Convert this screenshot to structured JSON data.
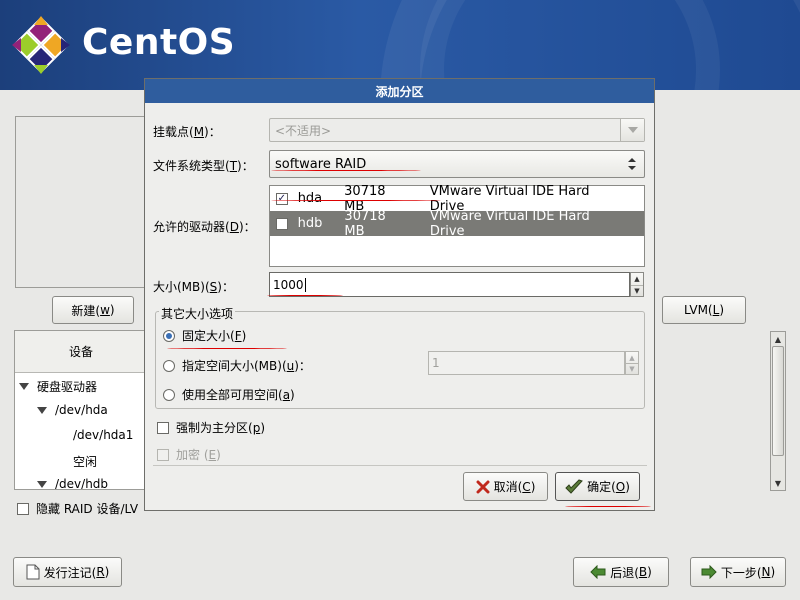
{
  "header": {
    "brand": "CentOS"
  },
  "main": {
    "new_button": {
      "label": "新建(",
      "mnemonic": "w",
      "suffix": ")"
    },
    "lvm_button": {
      "label": "LVM(",
      "mnemonic": "L",
      "suffix": ")"
    },
    "tree": {
      "column_header": "设备",
      "rows": [
        "硬盘驱动器",
        "/dev/hda",
        "/dev/hda1",
        "空闲",
        "/dev/hdb"
      ]
    },
    "hide_raid_label": "隐藏 RAID 设备/LV",
    "release_notes": {
      "label": "发行注记(",
      "mnemonic": "R",
      "suffix": ")"
    },
    "back": {
      "label": "后退(",
      "mnemonic": "B",
      "suffix": ")"
    },
    "next": {
      "label": "下一步(",
      "mnemonic": "N",
      "suffix": ")"
    }
  },
  "dialog": {
    "title": "添加分区",
    "mount_point": {
      "label": "挂载点(",
      "mnemonic": "M",
      "suffix": ")：",
      "value": "<不适用>"
    },
    "fs_type": {
      "label": "文件系统类型(",
      "mnemonic": "T",
      "suffix": ")：",
      "value": "software RAID"
    },
    "drives": {
      "label": "允许的驱动器(",
      "mnemonic": "D",
      "suffix": ")：",
      "rows": [
        {
          "checked": true,
          "name": "hda",
          "size": "30718 MB",
          "model": "VMware Virtual IDE Hard Drive"
        },
        {
          "checked": false,
          "name": "hdb",
          "size": "30718 MB",
          "model": "VMware Virtual IDE Hard Drive"
        }
      ]
    },
    "size": {
      "label": "大小(MB)(",
      "mnemonic": "S",
      "suffix": ")：",
      "value": "1000"
    },
    "options": {
      "legend": "其它大小选项",
      "fixed": {
        "label": "固定大小(",
        "mnemonic": "F",
        "suffix": ")"
      },
      "max": {
        "label": "指定空间大小(MB)(",
        "mnemonic": "u",
        "suffix": ")：",
        "value": "1"
      },
      "fill": {
        "label": "使用全部可用空间(",
        "mnemonic": "a",
        "suffix": ")"
      }
    },
    "primary": {
      "label": "强制为主分区(",
      "mnemonic": "p",
      "suffix": ")"
    },
    "encrypt": {
      "label": "加密 (",
      "mnemonic": "E",
      "suffix": ")"
    },
    "cancel": {
      "label": "取消(",
      "mnemonic": "C",
      "suffix": ")"
    },
    "ok": {
      "label": "确定(",
      "mnemonic": "O",
      "suffix": ")"
    }
  },
  "colors": {
    "title_bar": "#2f5d9e",
    "annotation": "#dd0000"
  }
}
